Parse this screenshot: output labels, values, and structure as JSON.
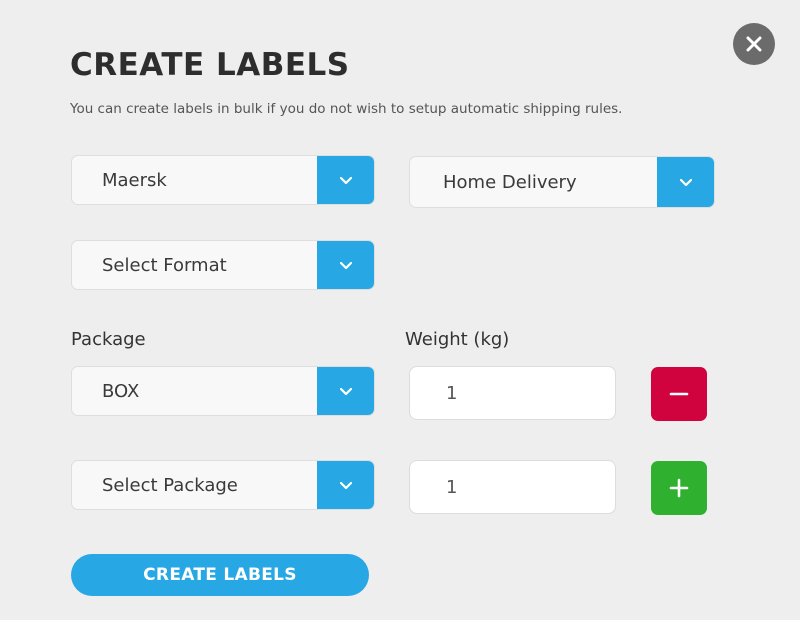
{
  "dialog": {
    "title": "CREATE LABELS",
    "subtitle": "You can create labels in bulk if you do not wish to setup automatic shipping rules."
  },
  "carrier": {
    "value": "Maersk"
  },
  "service": {
    "value": "Home Delivery"
  },
  "format": {
    "value": "Select Format"
  },
  "labels": {
    "package": "Package",
    "weight": "Weight (kg)"
  },
  "rows": [
    {
      "package": "BOX",
      "weight": "1",
      "action": "remove"
    },
    {
      "package": "Select Package",
      "weight": "1",
      "action": "add"
    }
  ],
  "create_button": {
    "label": "CREATE LABELS"
  },
  "icons": {
    "close": "close-icon",
    "dropdown": "chevron-down-icon",
    "remove": "minus-icon",
    "add": "plus-icon"
  },
  "colors": {
    "accent": "#27a7e3",
    "remove": "#d0033f",
    "add": "#2fb12f",
    "close_bg": "#6b6b6b",
    "background": "#eeeeee"
  }
}
